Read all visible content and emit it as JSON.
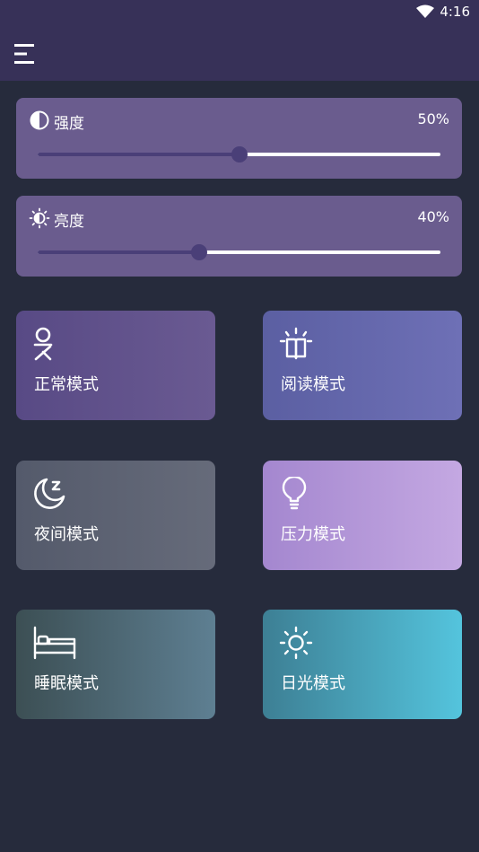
{
  "status": {
    "time": "4:16"
  },
  "sliders": [
    {
      "label": "强度",
      "value": "50%",
      "level": 0.5
    },
    {
      "label": "亮度",
      "value": "40%",
      "level": 0.4
    }
  ],
  "modes": [
    {
      "label": "正常模式",
      "icon": "person-icon"
    },
    {
      "label": "阅读模式",
      "icon": "book-lamp-icon"
    },
    {
      "label": "夜间模式",
      "icon": "moon-icon"
    },
    {
      "label": "压力模式",
      "icon": "lightbulb-icon"
    },
    {
      "label": "睡眠模式",
      "icon": "bed-icon"
    },
    {
      "label": "日光模式",
      "icon": "sun-icon"
    }
  ],
  "colors": {
    "background": "#262b3c",
    "appbar": "#373158",
    "slider_card": "#6a5c8e",
    "slider_fill": "#4a3f78",
    "normal": [
      "#584a85",
      "#6a5a92"
    ],
    "reading": [
      "#5b5fa2",
      "#6e70b6"
    ],
    "night": [
      "#545a6b",
      "#666b7a"
    ],
    "stress": [
      "#a487cf",
      "#c4a8e2"
    ],
    "sleep": [
      "#3c4f54",
      "#5e7f92"
    ],
    "daylight": [
      "#3d7f94",
      "#54c4dd"
    ]
  }
}
